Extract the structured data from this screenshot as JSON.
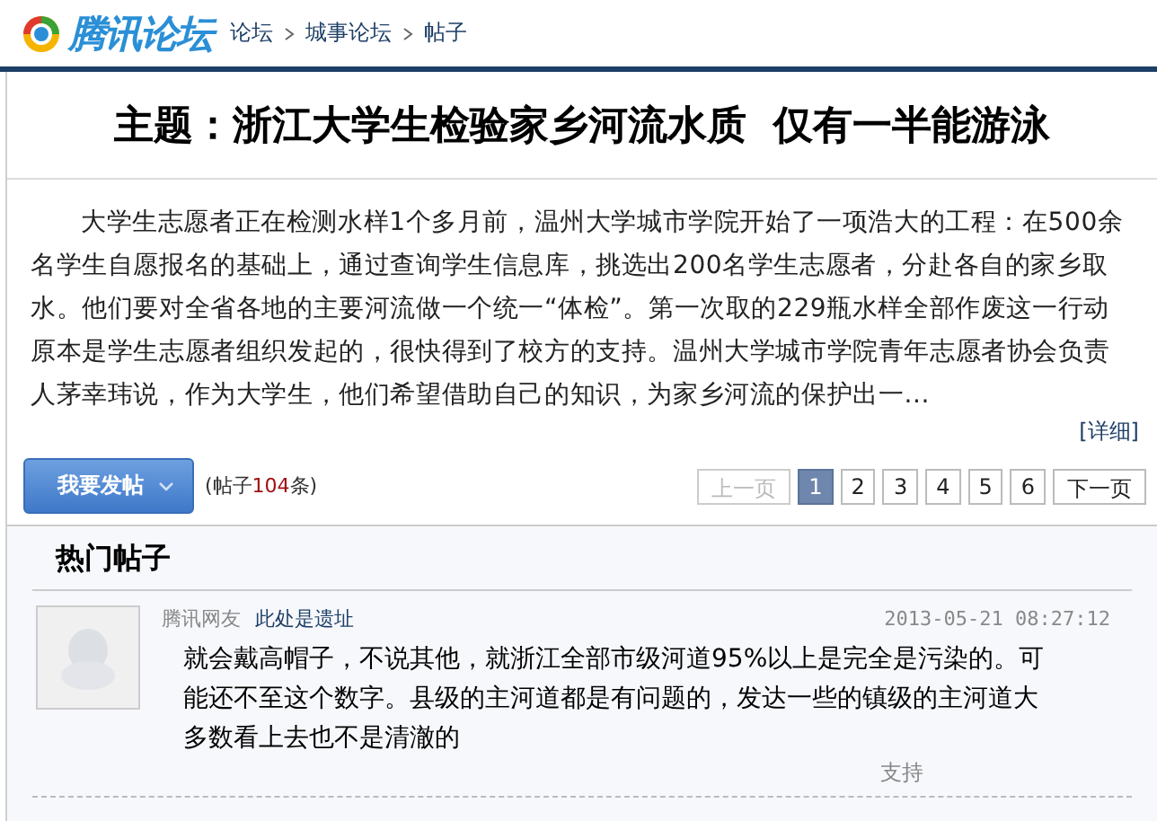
{
  "header": {
    "logo": "腾讯论坛",
    "breadcrumbs": [
      {
        "label": "论坛"
      },
      {
        "label": "城事论坛"
      },
      {
        "label": "帖子"
      }
    ]
  },
  "topic": {
    "title": "主题：浙江大学生检验家乡河流水质  仅有一半能游泳",
    "summary": "大学生志愿者正在检测水样1个多月前，温州大学城市学院开始了一项浩大的工程：在500余名学生自愿报名的基础上，通过查询学生信息库，挑选出200名学生志愿者，分赴各自的家乡取水。他们要对全省各地的主要河流做一个统一“体检”。第一次取的229瓶水样全部作废这一行动原本是学生志愿者组织发起的，很快得到了校方的支持。温州大学城市学院青年志愿者协会负责人茅幸玮说，作为大学生，他们希望借助自己的知识，为家乡河流的保护出一...",
    "detail_link": "[详细]"
  },
  "toolbar": {
    "post_button": "我要发帖",
    "count_prefix": "(帖子",
    "count": "104",
    "count_suffix": "条)",
    "pager": [
      {
        "label": "上一页",
        "kind": "prev",
        "disabled": true,
        "selected": false
      },
      {
        "label": "1",
        "kind": "page",
        "disabled": false,
        "selected": true
      },
      {
        "label": "2",
        "kind": "page",
        "disabled": false,
        "selected": false
      },
      {
        "label": "3",
        "kind": "page",
        "disabled": false,
        "selected": false
      },
      {
        "label": "4",
        "kind": "page",
        "disabled": false,
        "selected": false
      },
      {
        "label": "5",
        "kind": "page",
        "disabled": false,
        "selected": false
      },
      {
        "label": "6",
        "kind": "page",
        "disabled": false,
        "selected": false
      },
      {
        "label": "下一页",
        "kind": "next",
        "disabled": false,
        "selected": false
      }
    ]
  },
  "hot_posts": {
    "heading": "热门帖子",
    "posts": [
      {
        "author": "腾讯网友",
        "location": "此处是遗址",
        "time": "2013-05-21 08:27:12",
        "text": "就会戴高帽子，不说其他，就浙江全部市级河道95%以上是完全是污染的。可能还不至这个数字。县级的主河道都是有问题的，发达一些的镇级的主河道大多数看上去也不是清澈的",
        "support": "支持"
      }
    ]
  }
}
